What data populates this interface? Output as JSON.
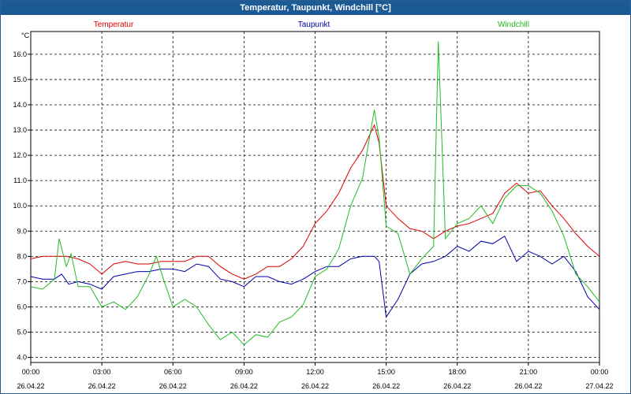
{
  "window": {
    "title": "Temperatur, Taupunkt, Windchill [°C]"
  },
  "chart_data": {
    "type": "line",
    "title": "Temperatur, Taupunkt, Windchill [°C]",
    "ylabel": "°C",
    "xlabel": "",
    "ylim": [
      3.8,
      16.9
    ],
    "xlim": [
      0,
      24
    ],
    "grid": true,
    "legend_placement": "top",
    "y_ticks": [
      "4.0",
      "5.0",
      "6.0",
      "7.0",
      "8.0",
      "9.0",
      "10.0",
      "11.0",
      "12.0",
      "13.0",
      "14.0",
      "15.0",
      "16.0"
    ],
    "x_ticks": [
      {
        "time": "00:00",
        "date": "26.04.22"
      },
      {
        "time": "03:00",
        "date": "26.04.22"
      },
      {
        "time": "06:00",
        "date": "26.04.22"
      },
      {
        "time": "09:00",
        "date": "26.04.22"
      },
      {
        "time": "12:00",
        "date": "26.04.22"
      },
      {
        "time": "15:00",
        "date": "26.04.22"
      },
      {
        "time": "18:00",
        "date": "26.04.22"
      },
      {
        "time": "21:00",
        "date": "26.04.22"
      },
      {
        "time": "00:00",
        "date": "27.04.22"
      }
    ],
    "series": [
      {
        "name": "Temperatur",
        "color": "#dd0000",
        "points": [
          [
            0,
            7.9
          ],
          [
            0.5,
            8.0
          ],
          [
            1.0,
            8.0
          ],
          [
            1.5,
            8.0
          ],
          [
            2.0,
            7.9
          ],
          [
            2.5,
            7.7
          ],
          [
            3.0,
            7.3
          ],
          [
            3.5,
            7.7
          ],
          [
            4.0,
            7.8
          ],
          [
            4.5,
            7.7
          ],
          [
            5.0,
            7.7
          ],
          [
            5.5,
            7.8
          ],
          [
            6.0,
            7.8
          ],
          [
            6.5,
            7.8
          ],
          [
            7.0,
            8.0
          ],
          [
            7.5,
            8.0
          ],
          [
            8.0,
            7.6
          ],
          [
            8.5,
            7.3
          ],
          [
            9.0,
            7.1
          ],
          [
            9.5,
            7.3
          ],
          [
            10.0,
            7.6
          ],
          [
            10.5,
            7.6
          ],
          [
            11.0,
            7.9
          ],
          [
            11.5,
            8.4
          ],
          [
            12.0,
            9.3
          ],
          [
            12.5,
            9.8
          ],
          [
            13.0,
            10.5
          ],
          [
            13.5,
            11.5
          ],
          [
            14.0,
            12.2
          ],
          [
            14.5,
            13.2
          ],
          [
            14.7,
            12.5
          ],
          [
            15.0,
            10.0
          ],
          [
            15.5,
            9.5
          ],
          [
            16.0,
            9.1
          ],
          [
            16.5,
            9.0
          ],
          [
            17.0,
            8.7
          ],
          [
            17.5,
            9.0
          ],
          [
            18.0,
            9.2
          ],
          [
            18.5,
            9.3
          ],
          [
            19.0,
            9.5
          ],
          [
            19.5,
            9.7
          ],
          [
            20.0,
            10.5
          ],
          [
            20.5,
            10.9
          ],
          [
            21.0,
            10.5
          ],
          [
            21.5,
            10.6
          ],
          [
            22.0,
            10.0
          ],
          [
            22.5,
            9.5
          ],
          [
            23.0,
            8.9
          ],
          [
            23.5,
            8.4
          ],
          [
            24.0,
            8.0
          ]
        ]
      },
      {
        "name": "Taupunkt",
        "color": "#0000aa",
        "points": [
          [
            0,
            7.2
          ],
          [
            0.5,
            7.1
          ],
          [
            1.0,
            7.1
          ],
          [
            1.3,
            7.3
          ],
          [
            1.6,
            6.9
          ],
          [
            2.0,
            7.0
          ],
          [
            2.5,
            6.9
          ],
          [
            3.0,
            6.7
          ],
          [
            3.5,
            7.2
          ],
          [
            4.0,
            7.3
          ],
          [
            4.5,
            7.4
          ],
          [
            5.0,
            7.4
          ],
          [
            5.5,
            7.5
          ],
          [
            6.0,
            7.5
          ],
          [
            6.5,
            7.4
          ],
          [
            7.0,
            7.7
          ],
          [
            7.5,
            7.6
          ],
          [
            8.0,
            7.1
          ],
          [
            8.5,
            7.0
          ],
          [
            9.0,
            6.8
          ],
          [
            9.5,
            7.2
          ],
          [
            10.0,
            7.2
          ],
          [
            10.5,
            7.0
          ],
          [
            11.0,
            6.9
          ],
          [
            11.5,
            7.1
          ],
          [
            12.0,
            7.4
          ],
          [
            12.5,
            7.6
          ],
          [
            13.0,
            7.6
          ],
          [
            13.5,
            7.9
          ],
          [
            14.0,
            8.0
          ],
          [
            14.5,
            8.0
          ],
          [
            14.7,
            7.8
          ],
          [
            15.0,
            5.6
          ],
          [
            15.5,
            6.3
          ],
          [
            16.0,
            7.3
          ],
          [
            16.5,
            7.7
          ],
          [
            17.0,
            7.8
          ],
          [
            17.5,
            8.0
          ],
          [
            18.0,
            8.4
          ],
          [
            18.5,
            8.2
          ],
          [
            19.0,
            8.6
          ],
          [
            19.5,
            8.5
          ],
          [
            20.0,
            8.8
          ],
          [
            20.5,
            7.8
          ],
          [
            21.0,
            8.2
          ],
          [
            21.5,
            8.0
          ],
          [
            22.0,
            7.7
          ],
          [
            22.5,
            8.0
          ],
          [
            23.0,
            7.4
          ],
          [
            23.5,
            6.4
          ],
          [
            24.0,
            5.9
          ]
        ]
      },
      {
        "name": "Windchill",
        "color": "#22bb22",
        "points": [
          [
            0,
            6.8
          ],
          [
            0.5,
            6.7
          ],
          [
            1.0,
            7.1
          ],
          [
            1.2,
            8.7
          ],
          [
            1.5,
            7.6
          ],
          [
            1.7,
            8.1
          ],
          [
            2.0,
            6.8
          ],
          [
            2.5,
            6.8
          ],
          [
            3.0,
            6.0
          ],
          [
            3.5,
            6.2
          ],
          [
            4.0,
            5.9
          ],
          [
            4.5,
            6.4
          ],
          [
            5.0,
            7.3
          ],
          [
            5.3,
            8.0
          ],
          [
            5.6,
            7.1
          ],
          [
            6.0,
            6.0
          ],
          [
            6.5,
            6.3
          ],
          [
            7.0,
            6.0
          ],
          [
            7.5,
            5.3
          ],
          [
            8.0,
            4.7
          ],
          [
            8.5,
            5.0
          ],
          [
            9.0,
            4.5
          ],
          [
            9.5,
            4.9
          ],
          [
            10.0,
            4.8
          ],
          [
            10.5,
            5.4
          ],
          [
            11.0,
            5.6
          ],
          [
            11.5,
            6.1
          ],
          [
            12.0,
            7.2
          ],
          [
            12.5,
            7.5
          ],
          [
            13.0,
            8.3
          ],
          [
            13.5,
            10.0
          ],
          [
            14.0,
            11.1
          ],
          [
            14.5,
            13.8
          ],
          [
            14.7,
            12.7
          ],
          [
            15.0,
            9.2
          ],
          [
            15.5,
            8.9
          ],
          [
            16.0,
            7.3
          ],
          [
            16.5,
            7.9
          ],
          [
            17.0,
            8.4
          ],
          [
            17.2,
            16.5
          ],
          [
            17.5,
            8.7
          ],
          [
            18.0,
            9.3
          ],
          [
            18.5,
            9.5
          ],
          [
            19.0,
            10.0
          ],
          [
            19.5,
            9.3
          ],
          [
            20.0,
            10.3
          ],
          [
            20.5,
            10.8
          ],
          [
            21.0,
            10.8
          ],
          [
            21.5,
            10.5
          ],
          [
            22.0,
            9.8
          ],
          [
            22.5,
            8.8
          ],
          [
            23.0,
            7.3
          ],
          [
            23.5,
            6.8
          ],
          [
            24.0,
            6.2
          ]
        ]
      }
    ]
  }
}
